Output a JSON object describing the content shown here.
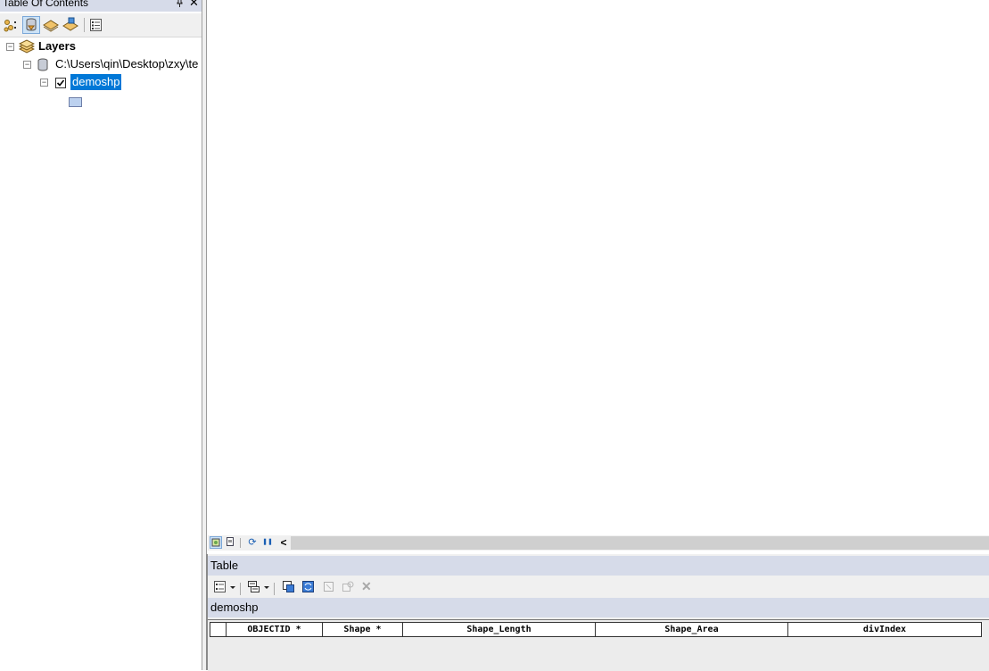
{
  "toc": {
    "title": "Table Of Contents",
    "pin_icon": "pin-icon",
    "close_glyph": "✕",
    "toolbar": [
      {
        "name": "list-by-drawing-order",
        "icon": "drawing-order-icon"
      },
      {
        "name": "list-by-source",
        "icon": "source-icon",
        "active": true
      },
      {
        "name": "list-by-visibility",
        "icon": "visibility-icon"
      },
      {
        "name": "list-by-selection",
        "icon": "selection-icon"
      },
      {
        "name": "options",
        "icon": "options-icon"
      }
    ],
    "tree": {
      "root_label": "Layers",
      "workspace_path": "C:\\Users\\qin\\Desktop\\zxy\\te",
      "layer_label": "demoshp",
      "layer_checked": true
    }
  },
  "view_bar": {
    "buttons": [
      "data-view",
      "layout-view",
      "refresh",
      "pause",
      "scroll-left"
    ],
    "scroll_left_glyph": "<",
    "pause_glyph": "❚❚",
    "refresh_glyph": "⟳"
  },
  "table": {
    "title": "Table",
    "tab_label": "demoshp",
    "columns": [
      "OBJECTID *",
      "Shape *",
      "Shape_Length",
      "Shape_Area",
      "divIndex"
    ],
    "delete_glyph": "✕"
  }
}
